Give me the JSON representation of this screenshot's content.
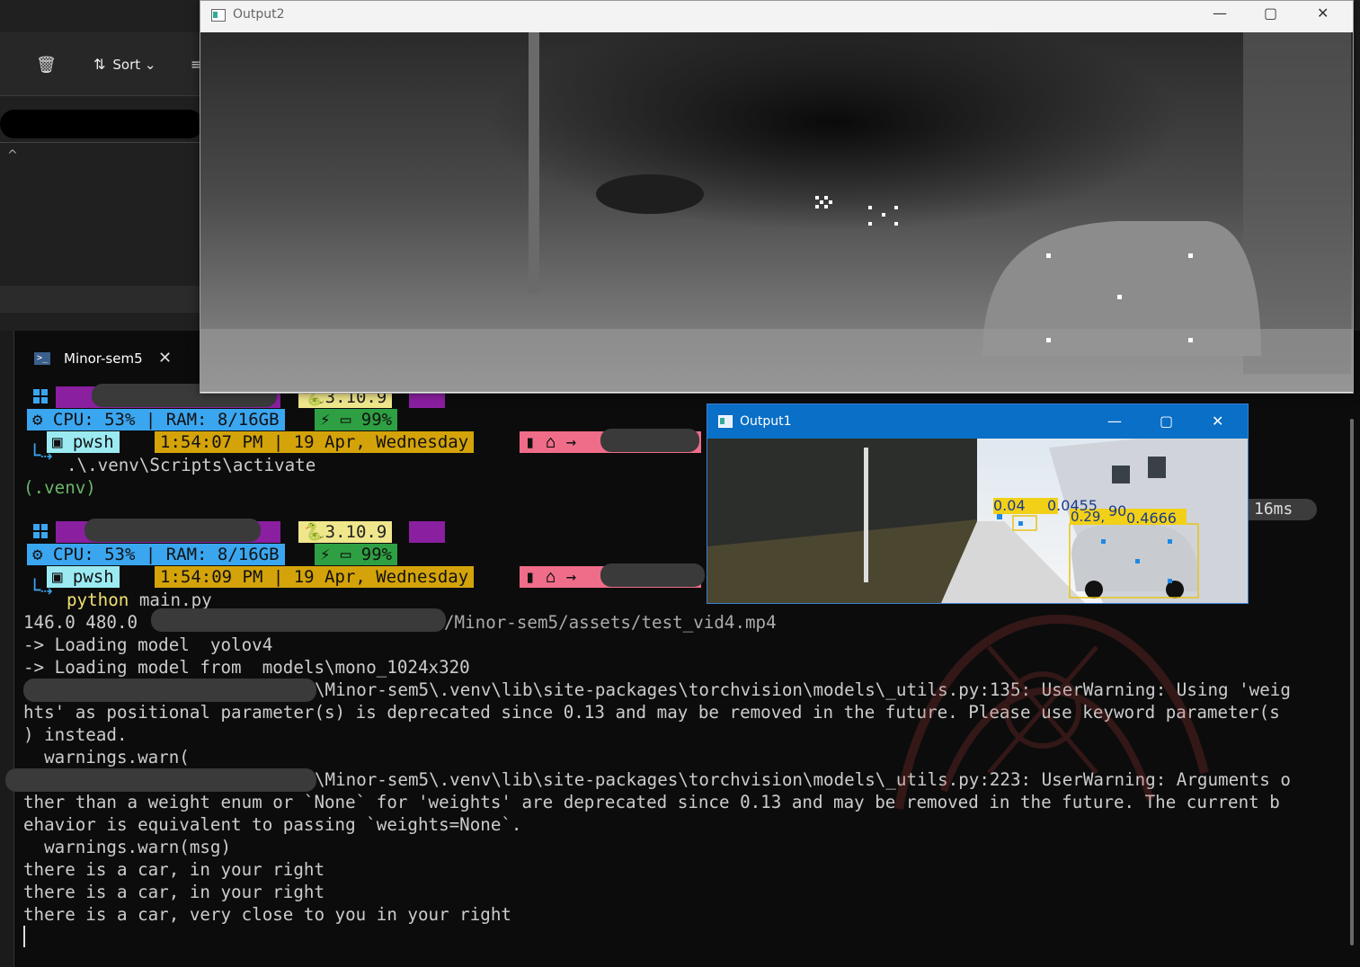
{
  "explorer": {
    "sort_label": "Sort"
  },
  "terminal": {
    "tab_title": "Minor-sem5",
    "prompt1": {
      "python_version": "3.10.9",
      "cpu": "CPU: 53%",
      "ram": "RAM: 8/16GB",
      "battery": "99%",
      "shell": "pwsh",
      "time": "1:54:07 PM | 19 Apr, Wednesday",
      "command": ".\\.venv\\Scripts\\activate"
    },
    "venv": "(.venv)",
    "prompt2": {
      "python_version": "3.10.9",
      "cpu": "CPU: 53%",
      "ram": "RAM: 8/16GB",
      "battery": "99%",
      "shell": "pwsh",
      "time": "1:54:09 PM | 19 Apr, Wednesday",
      "command_kw": "python",
      "command_rest": " main.py"
    },
    "timing": "16ms",
    "output": [
      "146.0 480.0",
      "/Minor-sem5/assets/test_vid4.mp4",
      "-> Loading model  yolov4",
      "-> Loading model from  models\\mono_1024x320",
      "\\Minor-sem5\\.venv\\lib\\site-packages\\torchvision\\models\\_utils.py:135: UserWarning: Using 'weig",
      "hts' as positional parameter(s) is deprecated since 0.13 and may be removed in the future. Please use keyword parameter(s",
      ") instead.",
      "  warnings.warn(",
      "\\Minor-sem5\\.venv\\lib\\site-packages\\torchvision\\models\\_utils.py:223: UserWarning: Arguments o",
      "ther than a weight enum or `None` for 'weights' are deprecated since 0.13 and may be removed in the future. The current b",
      "ehavior is equivalent to passing `weights=None`.",
      "  warnings.warn(msg)",
      "there is a car, in your right",
      "there is a car, in your right",
      "there is a car, very close to you in your right"
    ]
  },
  "output2": {
    "title": "Output2"
  },
  "output1": {
    "title": "Output1",
    "labels": [
      "0.04",
      "0.0455",
      "90",
      "0.29,",
      "0.4666"
    ]
  }
}
